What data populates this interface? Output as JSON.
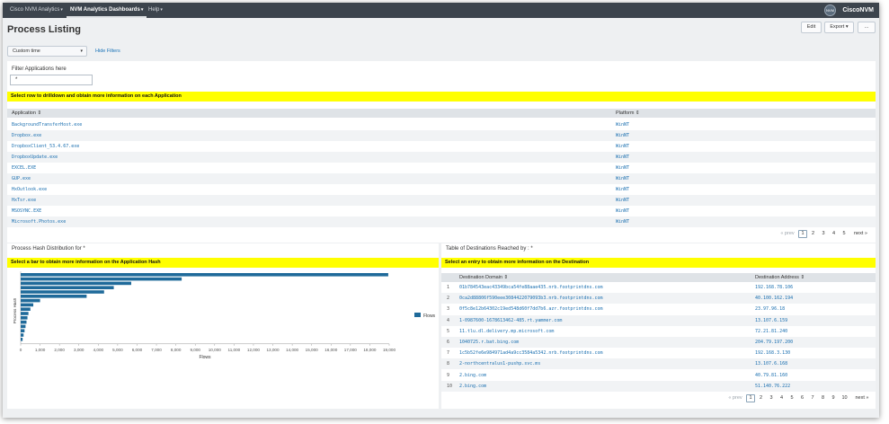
{
  "nav": {
    "items": [
      "Cisco NVM Analytics",
      "NVM Analytics Dashboards",
      "Help"
    ],
    "logo_text": "NVM",
    "app_name": "CiscoNVM"
  },
  "page": {
    "title": "Process Listing",
    "edit_label": "Edit",
    "export_label": "Export",
    "more_label": "..."
  },
  "filters": {
    "time_value": "Custom time",
    "hide_label": "Hide Filters",
    "filter_label": "Filter Applications here",
    "filter_value": "*"
  },
  "apps": {
    "banner": "Select row to drilldown and obtain more information on each Application",
    "col_application": "Application",
    "col_platform": "Platform",
    "rows": [
      [
        "BackgroundTransferHost.exe",
        "WinNT"
      ],
      [
        "Dropbox.exe",
        "WinNT"
      ],
      [
        "DropboxClient_53.4.67.exe",
        "WinNT"
      ],
      [
        "DropboxUpdate.exe",
        "WinNT"
      ],
      [
        "EXCEL.EXE",
        "WinNT"
      ],
      [
        "GUP.exe",
        "WinNT"
      ],
      [
        "HxOutlook.exe",
        "WinNT"
      ],
      [
        "HxTsr.exe",
        "WinNT"
      ],
      [
        "MSOSYNC.EXE",
        "WinNT"
      ],
      [
        "Microsoft.Photos.exe",
        "WinNT"
      ]
    ],
    "pager": {
      "prev": "« prev",
      "pages": [
        "1",
        "2",
        "3",
        "4",
        "5"
      ],
      "next": "next »"
    }
  },
  "hash": {
    "title": "Process Hash Distribution for *",
    "banner": "Select a bar to obtain more information on the Application Hash"
  },
  "dest": {
    "title": "Table of Destinations Reached by : *",
    "banner": "Select an entry to obtain more information on the Destination",
    "col_domain": "Destination Domain",
    "col_address": "Destination Address",
    "rows": [
      [
        "1",
        "01b784543eac43349bca54fe88aae435.nrb.footprintdns.com",
        "192.168.78.106"
      ],
      [
        "2",
        "0ca2d88806f590eee3084422079093b3.nrb.footprintdns.com",
        "40.100.162.194"
      ],
      [
        "3",
        "0f5c8e12b64302c19ed548d60f7dd7b6.azr.footprintdns.com",
        "23.97.96.18"
      ],
      [
        "4",
        "1-0987600-1678613462-485.rt.yammer.com",
        "13.107.6.159"
      ],
      [
        "5",
        "11.tlu.dl.delivery.mp.microsoft.com",
        "72.21.81.240"
      ],
      [
        "6",
        "1040725.r.bat.bing.com",
        "204.79.197.200"
      ],
      [
        "7",
        "1c5b52fe6e984971ad4a9cc3584a5342.nrb.footprintdns.com",
        "192.168.3.130"
      ],
      [
        "8",
        "2-northcentralus1-pushp.svc.ms",
        "13.107.6.168"
      ],
      [
        "9",
        "2.bing.com",
        "40.79.81.160"
      ],
      [
        "10",
        "2.bing.com",
        "51.140.76.222"
      ]
    ],
    "pager": {
      "prev": "« prev",
      "pages": [
        "1",
        "2",
        "3",
        "4",
        "5",
        "6",
        "7",
        "8",
        "9",
        "10"
      ],
      "next": "next »"
    }
  },
  "colors": {
    "bar": "#1f6a9a",
    "banner": "#ffff00",
    "topbar": "#3c444d"
  },
  "chart_data": {
    "type": "bar",
    "orientation": "horizontal",
    "xlabel": "Flows",
    "ylabel": "Process Hash",
    "xlim": [
      0,
      19000
    ],
    "xticks": [
      "0",
      "1,000",
      "2,000",
      "3,000",
      "4,000",
      "5,000",
      "6,000",
      "7,000",
      "8,000",
      "9,000",
      "10,000",
      "11,000",
      "12,000",
      "13,000",
      "14,000",
      "15,000",
      "16,000",
      "17,000",
      "18,000",
      "19,000"
    ],
    "series": [
      {
        "name": "Flows",
        "values": [
          18950,
          8300,
          5700,
          4800,
          4300,
          3400,
          1000,
          650,
          500,
          400,
          350,
          300,
          250,
          200,
          150,
          100
        ]
      }
    ],
    "legend": "right",
    "grid": false
  }
}
